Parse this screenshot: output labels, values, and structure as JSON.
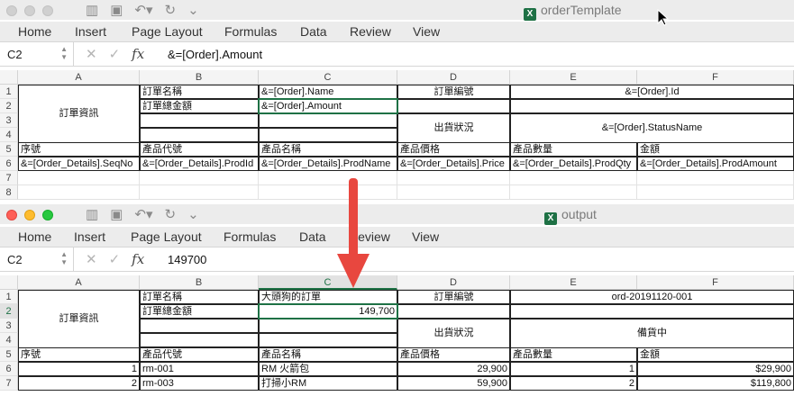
{
  "top_window": {
    "title": "orderTemplate",
    "ribbon": [
      "Home",
      "Insert",
      "Page Layout",
      "Formulas",
      "Data",
      "Review",
      "View"
    ],
    "name_box": "C2",
    "formula": "&=[Order].Amount",
    "columns": [
      "A",
      "B",
      "C",
      "D",
      "E",
      "F"
    ],
    "rows": [
      "1",
      "2",
      "3",
      "4",
      "5",
      "6",
      "7",
      "8"
    ],
    "cells": {
      "order_info": "訂單資訊",
      "order_name_label": "訂單名稱",
      "order_name_value": "&=[Order].Name",
      "order_no_label": "訂單編號",
      "order_no_value": "&=[Order].Id",
      "total_label": "訂單總金額",
      "total_value": "&=[Order].Amount",
      "ship_label": "出貨狀況",
      "ship_value": "&=[Order].StatusName",
      "h_seq": "序號",
      "h_code": "產品代號",
      "h_name": "產品名稱",
      "h_price": "產品價格",
      "h_qty": "產品數量",
      "h_amount": "金額",
      "d_seq": "&=[Order_Details].SeqNo",
      "d_code": "&=[Order_Details].ProdId",
      "d_name": "&=[Order_Details].ProdName",
      "d_price": "&=[Order_Details].Price",
      "d_qty": "&=[Order_Details].ProdQty",
      "d_amount": "&=[Order_Details].ProdAmount"
    }
  },
  "bottom_window": {
    "title": "output",
    "app_icon": "excel-icon",
    "ribbon": [
      "Home",
      "Insert",
      "Page Layout",
      "Formulas",
      "Data",
      "Review",
      "View"
    ],
    "name_box": "C2",
    "formula": "149700",
    "columns": [
      "A",
      "B",
      "C",
      "D",
      "E",
      "F"
    ],
    "rows": [
      "1",
      "2",
      "3",
      "4",
      "5",
      "6",
      "7"
    ],
    "cells": {
      "order_info": "訂單資訊",
      "order_name_label": "訂單名稱",
      "order_name_value": "大頭狗的訂單",
      "order_no_label": "訂單編號",
      "order_no_value": "ord-20191120-001",
      "total_label": "訂單總金額",
      "total_value": "149,700",
      "ship_label": "出貨狀況",
      "ship_value": "備貨中",
      "h_seq": "序號",
      "h_code": "產品代號",
      "h_name": "產品名稱",
      "h_price": "產品價格",
      "h_qty": "產品數量",
      "h_amount": "金額",
      "items": [
        {
          "seq": "1",
          "code": "rm-001",
          "name": "RM 火箭包",
          "price": "29,900",
          "qty": "1",
          "amount": "$29,900"
        },
        {
          "seq": "2",
          "code": "rm-003",
          "name": "打掃小RM",
          "price": "59,900",
          "qty": "2",
          "amount": "$119,800"
        }
      ]
    }
  },
  "colors": {
    "arrow": "#e8473f",
    "selection": "#1e7145"
  }
}
